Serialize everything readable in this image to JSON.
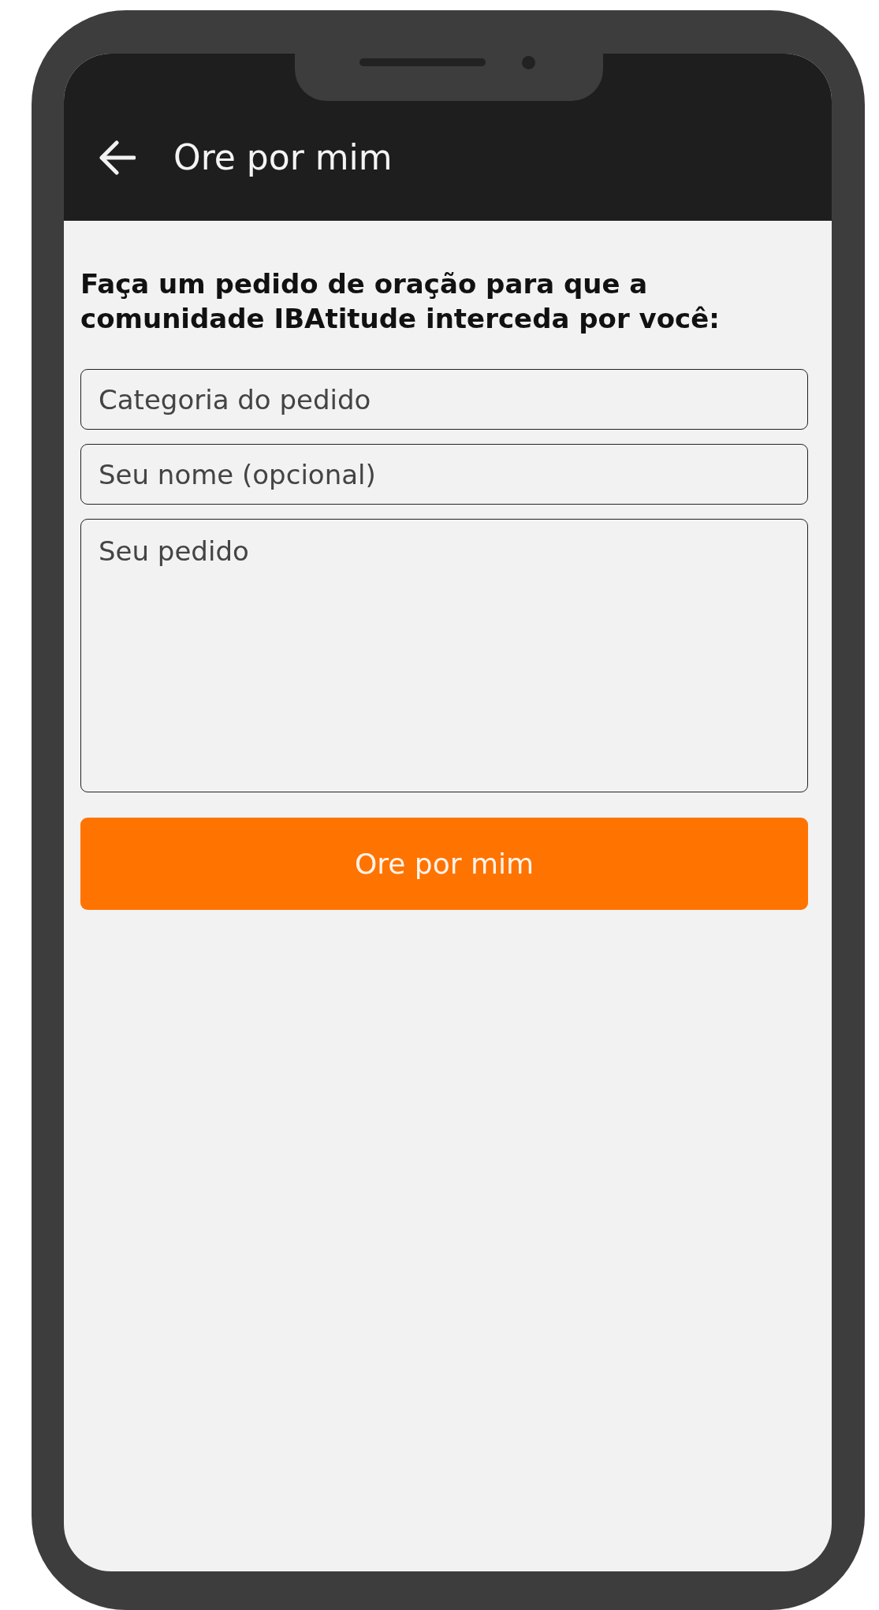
{
  "app_bar": {
    "title": "Ore por mim"
  },
  "prompt": "Faça um pedido de oração para que a comunidade IBAtitude interceda por você:",
  "fields": [
    {
      "kind": "input",
      "placeholder": "Categoria do pedido"
    },
    {
      "kind": "input",
      "placeholder": "Seu nome (opcional)"
    },
    {
      "kind": "textarea",
      "placeholder": "Seu pedido"
    }
  ],
  "submit_button": "Ore por mim"
}
